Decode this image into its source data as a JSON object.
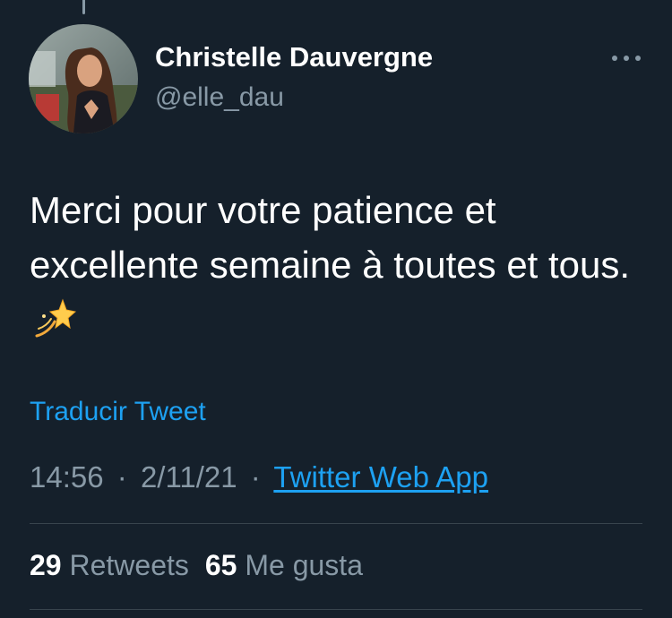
{
  "tweet": {
    "author": {
      "display_name": "Christelle Dauvergne",
      "handle": "@elle_dau",
      "avatar_icon": "profile-photo"
    },
    "more_icon": "more-horizontal-icon",
    "text": "Merci pour votre patience et excellente semaine à toutes et tous.",
    "emoji": "dizzy-star-emoji",
    "translate_label": "Traducir Tweet",
    "time": "14:56",
    "separator": "·",
    "date": "2/11/21",
    "source": "Twitter Web App",
    "stats": {
      "retweets_count": "29",
      "retweets_label": "Retweets",
      "likes_count": "65",
      "likes_label": "Me gusta"
    }
  },
  "colors": {
    "background": "#15202b",
    "text": "#ffffff",
    "secondary_text": "#8899a6",
    "accent": "#1da1f2",
    "divider": "#38444d"
  }
}
